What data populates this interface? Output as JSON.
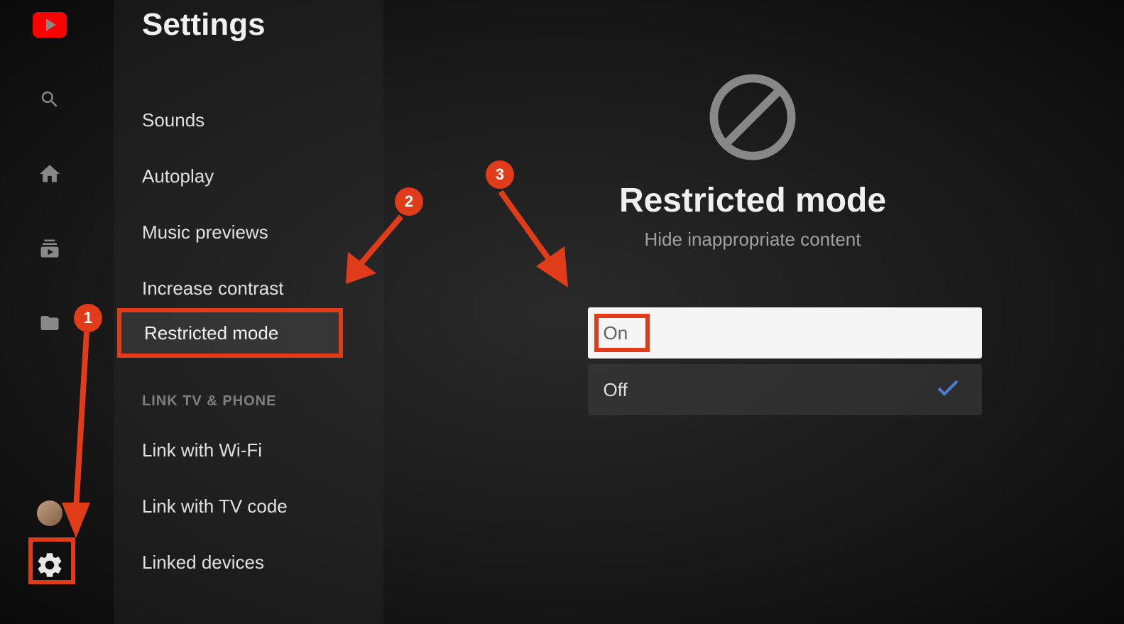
{
  "sidebar": {
    "items": [
      "youtube",
      "search",
      "home",
      "subscriptions",
      "folder"
    ]
  },
  "settings": {
    "title": "Settings",
    "items": [
      {
        "label": "Sounds"
      },
      {
        "label": "Autoplay"
      },
      {
        "label": "Music previews"
      },
      {
        "label": "Increase contrast"
      },
      {
        "label": "Restricted mode"
      }
    ],
    "section_header": "LINK TV & PHONE",
    "link_items": [
      {
        "label": "Link with Wi-Fi"
      },
      {
        "label": "Link with TV code"
      },
      {
        "label": "Linked devices"
      }
    ]
  },
  "main": {
    "title": "Restricted mode",
    "subtitle": "Hide inappropriate content",
    "option_on": "On",
    "option_off": "Off"
  },
  "annotations": {
    "badge1": "1",
    "badge2": "2",
    "badge3": "3"
  }
}
